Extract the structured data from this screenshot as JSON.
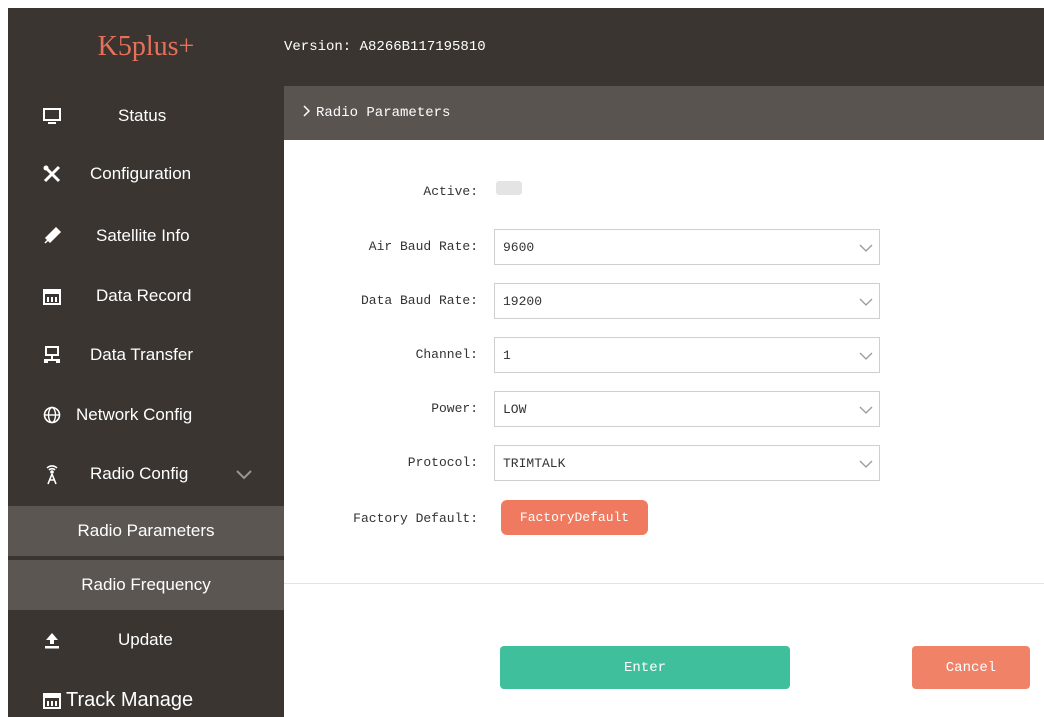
{
  "header": {
    "logo": "K5plus+",
    "version": "Version: A8266B117195810"
  },
  "sidebar": {
    "items": [
      {
        "label": "Status",
        "icon": "monitor-icon"
      },
      {
        "label": "Configuration",
        "icon": "tools-icon"
      },
      {
        "label": "Satellite Info",
        "icon": "satellite-icon"
      },
      {
        "label": "Data Record",
        "icon": "calendar-icon"
      },
      {
        "label": "Data Transfer",
        "icon": "network-transfer-icon"
      },
      {
        "label": "Network Config",
        "icon": "globe-icon"
      },
      {
        "label": "Radio Config",
        "icon": "antenna-icon",
        "expanded": true
      }
    ],
    "sub_items": [
      "Radio Parameters",
      "Radio Frequency"
    ],
    "items_after": [
      {
        "label": "Update",
        "icon": "upload-icon"
      },
      {
        "label": "Track Manage",
        "icon": "calendar-icon"
      }
    ]
  },
  "main": {
    "breadcrumb": "Radio Parameters",
    "form": {
      "active_label": "Active:",
      "air_baud_label": "Air Baud Rate:",
      "air_baud_value": "9600",
      "data_baud_label": "Data Baud Rate:",
      "data_baud_value": "19200",
      "channel_label": "Channel:",
      "channel_value": "1",
      "power_label": "Power:",
      "power_value": "LOW",
      "protocol_label": "Protocol:",
      "protocol_value": "TRIMTALK",
      "factory_label": "Factory Default:",
      "factory_button": "FactoryDefault"
    },
    "enter_button": "Enter",
    "cancel_button": "Cancel"
  },
  "colors": {
    "sidebar_bg": "#3a3530",
    "submenu_bg": "#5b5652",
    "logo": "#e86f5a",
    "enter": "#3fbf9c",
    "cancel": "#f08268"
  }
}
